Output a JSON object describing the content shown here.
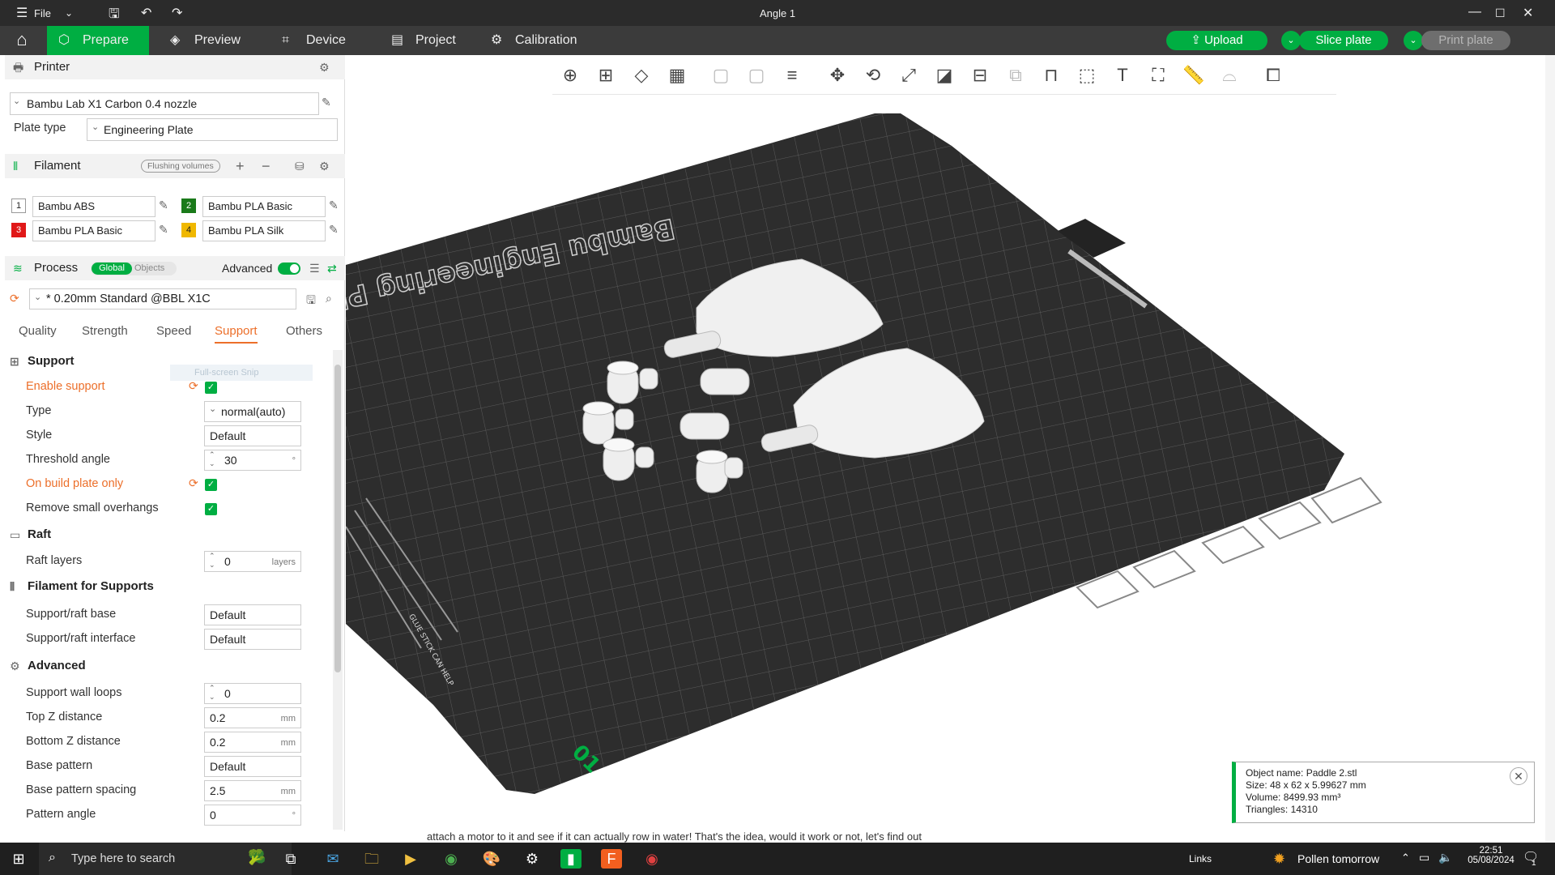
{
  "app": {
    "window_title": "Angle 1",
    "file_menu": "File"
  },
  "nav": {
    "tabs": [
      {
        "label": "Prepare"
      },
      {
        "label": "Preview"
      },
      {
        "label": "Device"
      },
      {
        "label": "Project"
      },
      {
        "label": "Calibration"
      }
    ],
    "upload_label": "Upload",
    "slice_label": "Slice plate",
    "print_label": "Print plate"
  },
  "printer": {
    "section_title": "Printer",
    "preset": "Bambu Lab X1 Carbon 0.4 nozzle",
    "plate_type_label": "Plate type",
    "plate_type": "Engineering Plate"
  },
  "filament": {
    "section_title": "Filament",
    "flushing_label": "Flushing volumes",
    "slots": [
      {
        "num": "1",
        "name": "Bambu ABS",
        "color": "#ffffff"
      },
      {
        "num": "2",
        "name": "Bambu PLA Basic",
        "color": "#1a7a1a"
      },
      {
        "num": "3",
        "name": "Bambu PLA Basic",
        "color": "#e01818"
      },
      {
        "num": "4",
        "name": "Bambu PLA Silk",
        "color": "#f0b800"
      }
    ]
  },
  "process": {
    "section_title": "Process",
    "global_label": "Global",
    "objects_label": "Objects",
    "advanced_label": "Advanced",
    "preset": "* 0.20mm Standard @BBL X1C",
    "tabs": [
      "Quality",
      "Strength",
      "Speed",
      "Support",
      "Others"
    ],
    "active_tab": "Support",
    "tooltip": "Full-screen Snip"
  },
  "support": {
    "group_title": "Support",
    "enable_support": "Enable support",
    "type_label": "Type",
    "type_value": "normal(auto)",
    "style_label": "Style",
    "style_value": "Default",
    "threshold_label": "Threshold angle",
    "threshold_value": "30",
    "threshold_unit": "°",
    "build_plate_only": "On build plate only",
    "remove_overhangs": "Remove small overhangs"
  },
  "raft": {
    "group_title": "Raft",
    "layers_label": "Raft layers",
    "layers_value": "0",
    "layers_unit": "layers"
  },
  "filament_supports": {
    "group_title": "Filament for Supports",
    "base_label": "Support/raft base",
    "base_value": "Default",
    "interface_label": "Support/raft interface",
    "interface_value": "Default"
  },
  "advanced": {
    "group_title": "Advanced",
    "wall_loops_label": "Support wall loops",
    "wall_loops_value": "0",
    "top_z_label": "Top Z distance",
    "top_z_value": "0.2",
    "bottom_z_label": "Bottom Z distance",
    "bottom_z_value": "0.2",
    "base_pattern_label": "Base pattern",
    "base_pattern_value": "Default",
    "base_spacing_label": "Base pattern spacing",
    "base_spacing_value": "2.5",
    "pattern_angle_label": "Pattern angle",
    "pattern_angle_value": "0",
    "unit_mm": "mm",
    "unit_deg": "°"
  },
  "plate": {
    "brand_text": "Bambu Engineering Plate",
    "plate_number": "01",
    "side_text": "GLUE STICK CAN HELP"
  },
  "object_info": {
    "name": "Object name: Paddle 2.stl",
    "size": "Size: 48 x 62 x 5.99627 mm",
    "volume": "Volume: 8499.93 mm³",
    "triangles": "Triangles: 14310"
  },
  "bg_text": "attach a motor to it and see if it can actually row in water! That's the idea, would it work or not, let's find out",
  "taskbar": {
    "search_placeholder": "Type here to search",
    "links_label": "Links",
    "weather": "Pollen tomorrow",
    "time": "22:51",
    "date": "05/08/2024",
    "notif_count": "1"
  },
  "colors": {
    "accent": "#00ae42",
    "modified": "#ec6f2a",
    "plate": "#3c3c3c"
  }
}
